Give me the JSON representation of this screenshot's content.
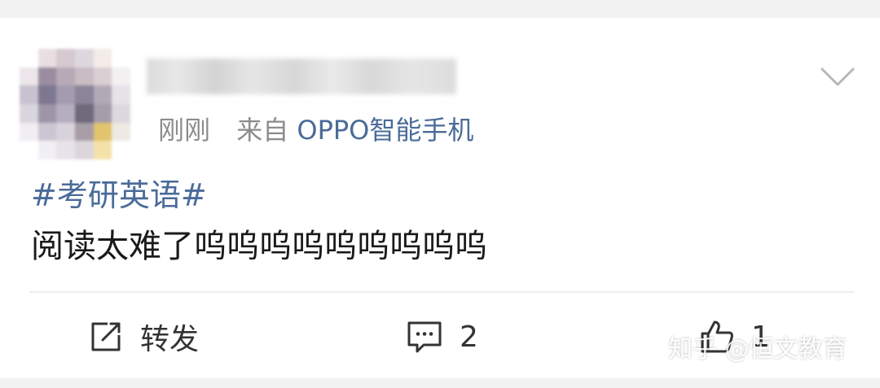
{
  "post": {
    "time": "刚刚",
    "source_prefix": "来自",
    "device": "OPPO智能手机",
    "hashtag": "#考研英语#",
    "text": "阅读太难了呜呜呜呜呜呜呜呜呜"
  },
  "actions": {
    "repost_label": "转发",
    "comment_count": "2",
    "like_count": "1"
  },
  "watermark": "知乎 @恒文教育",
  "colors": {
    "link": "#4a6b99",
    "meta": "#8c8c8c",
    "text": "#1a1a1a",
    "background": "#f2f2f2",
    "card": "#ffffff"
  },
  "icons": [
    "chevron-down-icon",
    "repost-icon",
    "comment-icon",
    "like-icon"
  ]
}
